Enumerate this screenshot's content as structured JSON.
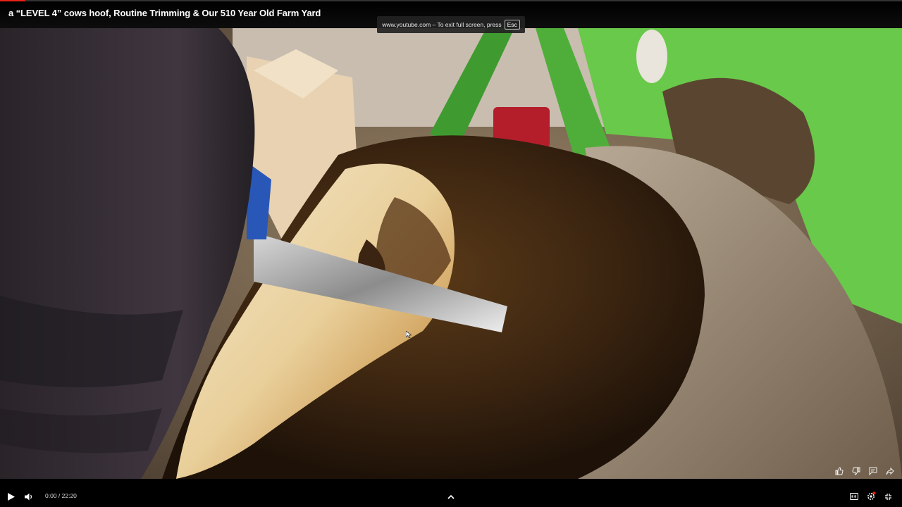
{
  "player": {
    "title": "a “LEVEL 4” cows hoof, Routine Trimming & Our 510 Year Old Farm Yard",
    "progress_fraction": 0.0,
    "time_current": "0:00",
    "time_total": "22:20",
    "time_separator": " / ",
    "accent_color": "#e62117"
  },
  "fullscreen_toast": {
    "message": "www.youtube.com – To exit full screen, press",
    "key": "Esc"
  },
  "quick_actions": {
    "icons": [
      "thumbs-up-icon",
      "thumbs-down-icon",
      "comment-icon",
      "share-icon"
    ]
  },
  "controls": {
    "left_icons": [
      "play-icon",
      "volume-icon"
    ],
    "center_icon": "chevron-up-icon",
    "right_icons": [
      "captions-icon",
      "settings-icon",
      "exit-fullscreen-icon"
    ]
  },
  "video": {
    "subject": "hoof-trimming-frame"
  }
}
